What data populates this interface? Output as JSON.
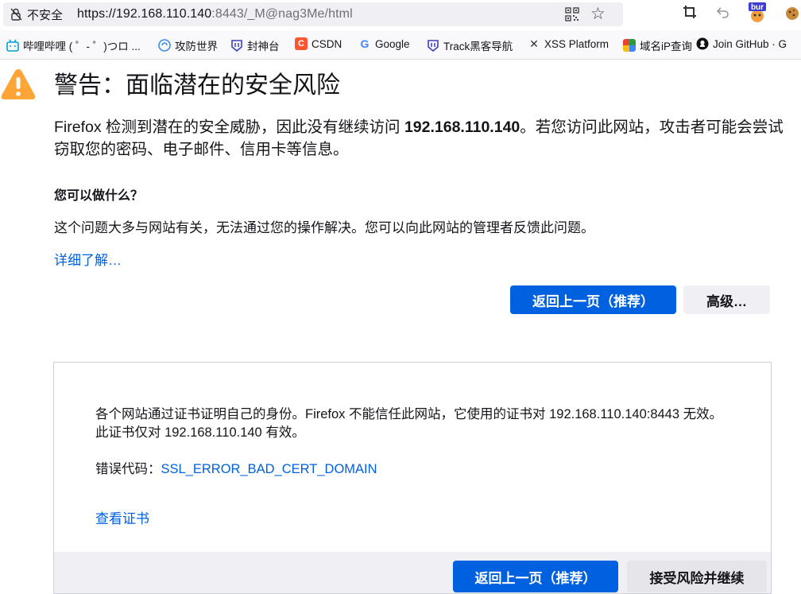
{
  "urlbar": {
    "insecure_label": "不安全",
    "url_main": "https://192.168.110.140",
    "url_rest": ":8443/_M@nag3Me/html"
  },
  "bookmarks": [
    {
      "label": "哔哩哔哩 ( ゜- ゜)つロ ...",
      "icon": "bilibili-icon",
      "color": "#00a1d6"
    },
    {
      "label": "攻防世界",
      "icon": "xctf-icon",
      "color": "#3c8ce7"
    },
    {
      "label": "封神台",
      "icon": "fengshentai-icon",
      "color": "#3a3fbf"
    },
    {
      "label": "CSDN",
      "icon": "csdn-icon",
      "color": "#fc5531"
    },
    {
      "label": "Google",
      "icon": "google-icon",
      "color": "#4285f4"
    },
    {
      "label": "Track黑客导航",
      "icon": "track-icon",
      "color": "#3a3fbf"
    },
    {
      "label": "XSS Platform",
      "icon": "xss-icon",
      "color": "#333333"
    },
    {
      "label": "域名iP查询",
      "icon": "domain-ip-icon",
      "color": "#2b9b3f"
    },
    {
      "label": "Join GitHub · G",
      "icon": "github-icon",
      "color": "#111111"
    }
  ],
  "page": {
    "title": "警告：面临潜在的安全风险",
    "desc_prefix": "Firefox 检测到潜在的安全威胁，因此没有继续访问 ",
    "desc_host": "192.168.110.140",
    "desc_suffix": "。若您访问此网站，攻击者可能会尝试窃取您的密码、电子邮件、信用卡等信息。",
    "what_heading": "您可以做什么？",
    "what_text": "这个问题大多与网站有关，无法通过您的操作解决。您可以向此网站的管理者反馈此问题。",
    "learn_more": "详细了解…",
    "go_back_button": "返回上一页（推荐）",
    "advanced_button": "高级…"
  },
  "advanced": {
    "text": "各个网站通过证书证明自己的身份。Firefox 不能信任此网站，它使用的证书对 192.168.110.140:8443 无效。 此证书仅对 192.168.110.140 有效。",
    "error_label": "错误代码：",
    "error_code": "SSL_ERROR_BAD_CERT_DOMAIN",
    "view_certificate": "查看证书",
    "go_back_button": "返回上一页（推荐）",
    "accept_button": "接受风险并继续"
  },
  "colors": {
    "accent": "#0061e0",
    "warning": "#ffa436"
  }
}
